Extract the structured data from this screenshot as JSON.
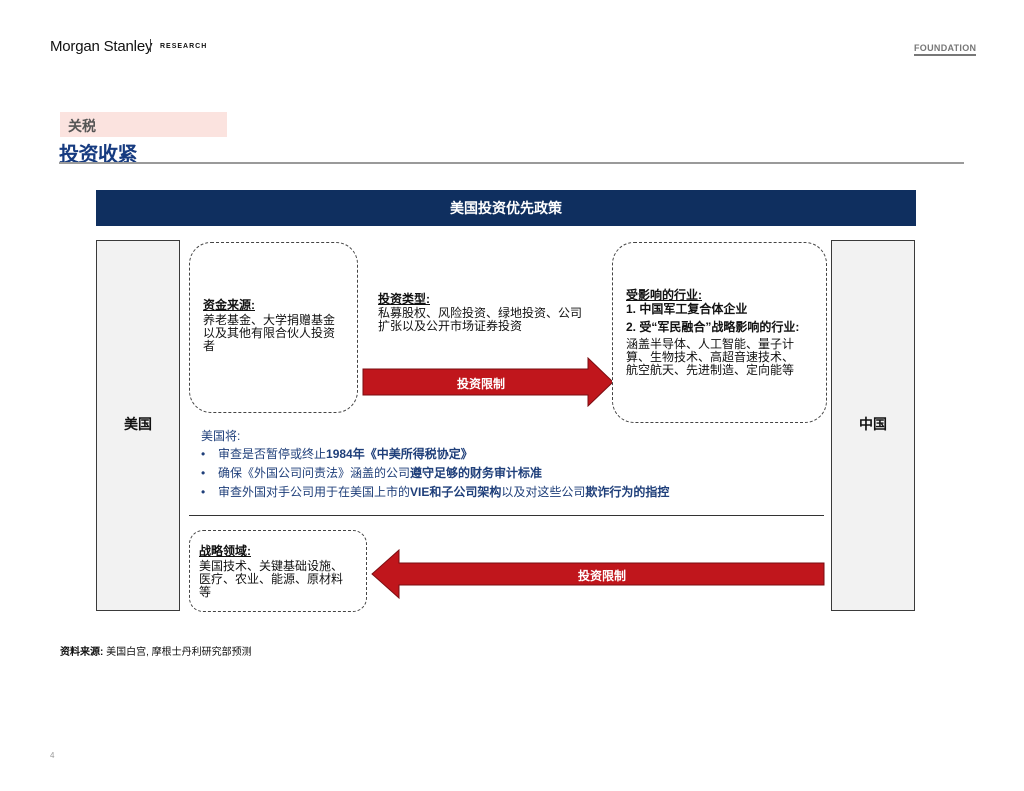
{
  "header": {
    "brand": "Morgan Stanley",
    "division": "RESEARCH",
    "series": "FOUNDATION"
  },
  "section_tag": "关税",
  "title": "投资收紧",
  "banner": "美国投资优先政策",
  "countries": {
    "left": "美国",
    "right": "中国"
  },
  "funding": {
    "heading": "资金来源:",
    "lines": [
      "养老基金、大学捐赠基金",
      "以及其他有限合伙人投资",
      "者"
    ]
  },
  "investment_types": {
    "heading": "投资类型:",
    "lines": [
      "私募股权、风险投资、绿地投资、公司",
      "扩张以及公开市场证券投资"
    ]
  },
  "affected_industries": {
    "heading": "受影响的行业:",
    "item1": "1. 中国军工复合体企业",
    "item2": "2. 受“军民融合”战略影响的行业:",
    "lines": [
      "涵盖半导体、人工智能、量子计",
      "算、生物技术、高超音速技术、",
      "航空航天、先进制造、定向能等"
    ]
  },
  "arrows": {
    "top_label": "投资限制",
    "bottom_label": "投资限制"
  },
  "us_will": {
    "intro": "美国将:",
    "b1_pre": "审查是否暂停或终止",
    "b1_bold": "1984年《中美所得税协定》",
    "b2_pre": "确保《外国公司问责法》涵盖的公司",
    "b2_bold": "遵守足够的财务审计标准",
    "b3_pre": "审查外国对手公司用于在美国上市的",
    "b3_bold1": "VIE和子公司架构",
    "b3_mid": "以及对这些公司",
    "b3_bold2": "欺诈行为的指控"
  },
  "strategic": {
    "heading": "战略领域:",
    "lines": [
      "美国技术、关键基础设施、",
      "医疗、农业、能源、原材料",
      "等"
    ]
  },
  "source": {
    "label": "资料来源:",
    "text": " 美国白宫, 摩根士丹利研究部预测"
  },
  "page_number": "4",
  "colors": {
    "navy": "#0f2f5f",
    "title_blue": "#163b80",
    "arrow_red": "#c0161c",
    "tag_pink": "#fbe3df"
  }
}
